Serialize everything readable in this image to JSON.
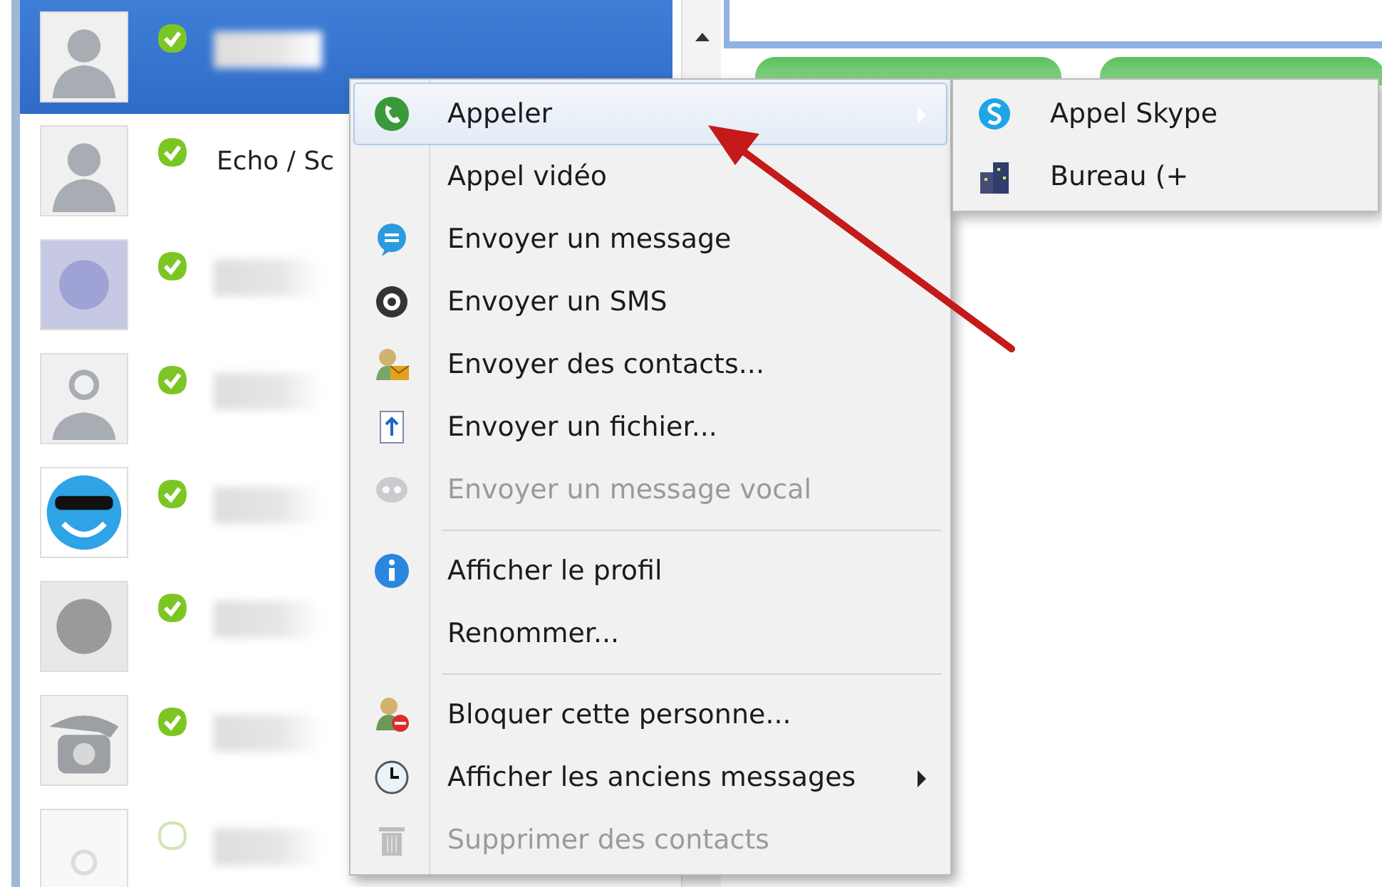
{
  "contacts": [
    {
      "selected": true,
      "online": true
    },
    {
      "name": "Echo / Sc",
      "selected": false,
      "online": true
    },
    {
      "selected": false,
      "online": true
    },
    {
      "selected": false,
      "online": true
    },
    {
      "selected": false,
      "online": true
    },
    {
      "selected": false,
      "online": true
    },
    {
      "selected": false,
      "online": true
    },
    {
      "selected": false,
      "online": false
    }
  ],
  "context_menu": [
    {
      "kind": "item",
      "label": "Appeler",
      "selected": true,
      "disabled": false,
      "submenu": true
    },
    {
      "kind": "item",
      "label": "Appel vidéo",
      "selected": false,
      "disabled": false,
      "submenu": false
    },
    {
      "kind": "item",
      "label": "Envoyer un message",
      "selected": false,
      "disabled": false,
      "submenu": false
    },
    {
      "kind": "item",
      "label": "Envoyer un SMS",
      "selected": false,
      "disabled": false,
      "submenu": false
    },
    {
      "kind": "item",
      "label": "Envoyer des contacts...",
      "selected": false,
      "disabled": false,
      "submenu": false
    },
    {
      "kind": "item",
      "label": "Envoyer un fichier...",
      "selected": false,
      "disabled": false,
      "submenu": false
    },
    {
      "kind": "item",
      "label": "Envoyer un message vocal",
      "selected": false,
      "disabled": true,
      "submenu": false
    },
    {
      "kind": "separator"
    },
    {
      "kind": "item",
      "label": "Afficher le profil",
      "selected": false,
      "disabled": false,
      "submenu": false
    },
    {
      "kind": "item",
      "label": "Renommer...",
      "selected": false,
      "disabled": false,
      "submenu": false
    },
    {
      "kind": "separator"
    },
    {
      "kind": "item",
      "label": "Bloquer cette personne...",
      "selected": false,
      "disabled": false,
      "submenu": false
    },
    {
      "kind": "item",
      "label": "Afficher les anciens messages",
      "selected": false,
      "disabled": false,
      "submenu": true
    },
    {
      "kind": "item",
      "label": "Supprimer des contacts",
      "selected": false,
      "disabled": true,
      "submenu": false
    }
  ],
  "submenu": [
    {
      "label": "Appel Skype"
    },
    {
      "label": "Bureau (+"
    }
  ]
}
